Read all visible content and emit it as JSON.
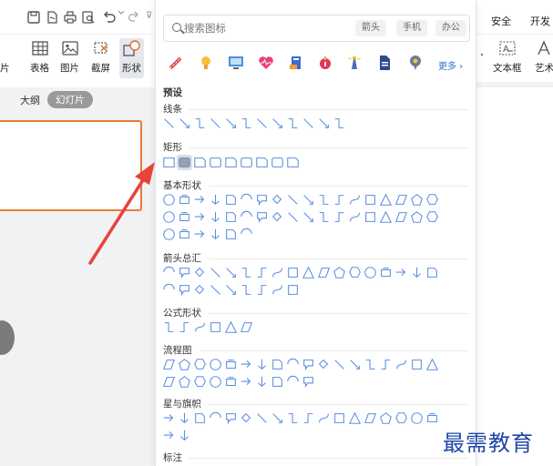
{
  "ribbon": {
    "quick_access_text": "⊽",
    "partial_left_label": "片",
    "buttons": [
      {
        "label": "表格",
        "icon": "table-icon"
      },
      {
        "label": "图片",
        "icon": "image-icon"
      },
      {
        "label": "截屏",
        "icon": "screenshot-icon"
      },
      {
        "label": "形状",
        "icon": "shapes-icon"
      }
    ],
    "right_tabs": [
      "安全",
      "开发"
    ],
    "right_buttons": [
      {
        "label": "文本框",
        "icon": "textbox-icon"
      },
      {
        "label": "艺术",
        "icon": "wordart-icon"
      }
    ]
  },
  "sidebar": {
    "tabs": [
      "大纲",
      "幻灯片"
    ],
    "active_tab": "幻灯片"
  },
  "shape_panel": {
    "search": {
      "placeholder": "搜索图标",
      "value": ""
    },
    "tags": [
      "箭头",
      "手机",
      "办公"
    ],
    "more_label": "更多",
    "preset_label": "预设",
    "sections": [
      {
        "title": "线条",
        "count": 12
      },
      {
        "title": "矩形",
        "count": 9
      },
      {
        "title": "基本形状",
        "count": 42
      },
      {
        "title": "箭头总汇",
        "count": 27
      },
      {
        "title": "公式形状",
        "count": 6
      },
      {
        "title": "流程图",
        "count": 28
      },
      {
        "title": "星与旗帜",
        "count": 20
      },
      {
        "title": "标注",
        "count": 0
      }
    ],
    "selected_shape": "rectangle"
  },
  "watermark": "最需教育",
  "colors": {
    "accent_orange": "#e97a38",
    "annotation_red": "#e8433b",
    "shape_stroke": "#5b8fe0",
    "link_blue": "#2f6fd6",
    "watermark_blue": "#1f47a8"
  }
}
